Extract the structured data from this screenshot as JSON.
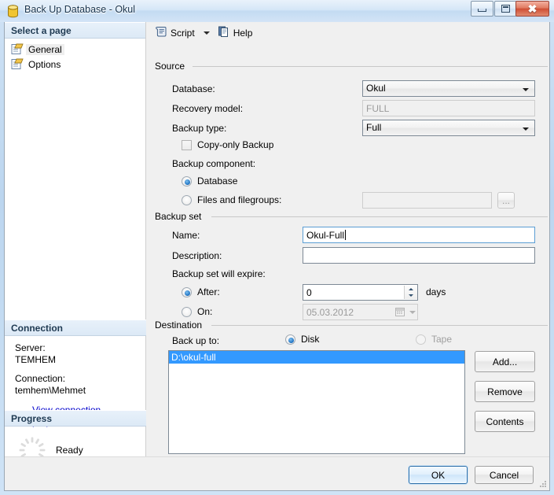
{
  "window": {
    "title": "Back Up Database - Okul",
    "icon": "database-cylinder-icon",
    "minimize_label": "Minimize",
    "maximize_label": "Maximize",
    "close_label": "Close"
  },
  "sidebar": {
    "header": "Select a page",
    "items": [
      {
        "label": "General",
        "icon": "page-icon",
        "selected": true
      },
      {
        "label": "Options",
        "icon": "page-icon",
        "selected": false
      }
    ],
    "connection": {
      "header": "Connection",
      "server_label": "Server:",
      "server_value": "TEMHEM",
      "connection_label": "Connection:",
      "connection_value": "temhem\\Mehmet",
      "link_text": "View connection properties",
      "link_icon": "connection-properties-icon"
    },
    "progress": {
      "header": "Progress",
      "status": "Ready",
      "spinner_icon": "progress-spinner-icon"
    }
  },
  "toolbar": {
    "script_label": "Script",
    "script_icon": "script-scroll-icon",
    "script_dropdown_icon": "chevron-down-icon",
    "help_label": "Help",
    "help_icon": "help-pages-icon"
  },
  "source": {
    "group_title": "Source",
    "database_label": "Database:",
    "database_value": "Okul",
    "recovery_model_label": "Recovery model:",
    "recovery_model_value": "FULL",
    "backup_type_label": "Backup type:",
    "backup_type_value": "Full",
    "copy_only_label": "Copy-only Backup",
    "copy_only_checked": false,
    "backup_component_label": "Backup component:",
    "component_database_label": "Database",
    "component_database_selected": true,
    "component_files_label": "Files and filegroups:",
    "component_files_selected": false,
    "files_value": "",
    "browse_label": "..."
  },
  "backup_set": {
    "group_title": "Backup set",
    "name_label": "Name:",
    "name_value": "Okul-Full",
    "description_label": "Description:",
    "description_value": "",
    "expire_label": "Backup set will expire:",
    "after_label": "After:",
    "after_selected": true,
    "after_value": "0",
    "days_label": "days",
    "on_label": "On:",
    "on_selected": false,
    "on_value": "05.03.2012"
  },
  "destination": {
    "group_title": "Destination",
    "backup_to_label": "Back up to:",
    "disk_label": "Disk",
    "disk_selected": true,
    "tape_label": "Tape",
    "tape_selected": false,
    "tape_disabled": true,
    "paths": [
      {
        "value": "D:\\okul-full",
        "selected": true
      }
    ],
    "add_label": "Add...",
    "remove_label": "Remove",
    "contents_label": "Contents"
  },
  "footer": {
    "ok_label": "OK",
    "cancel_label": "Cancel"
  },
  "colors": {
    "selection_blue": "#3399ff",
    "link_blue": "#0000cc",
    "titlebar_top": "#e9f2fb",
    "close_red": "#cf4f34",
    "radio_dot": "#1b6fc0"
  }
}
